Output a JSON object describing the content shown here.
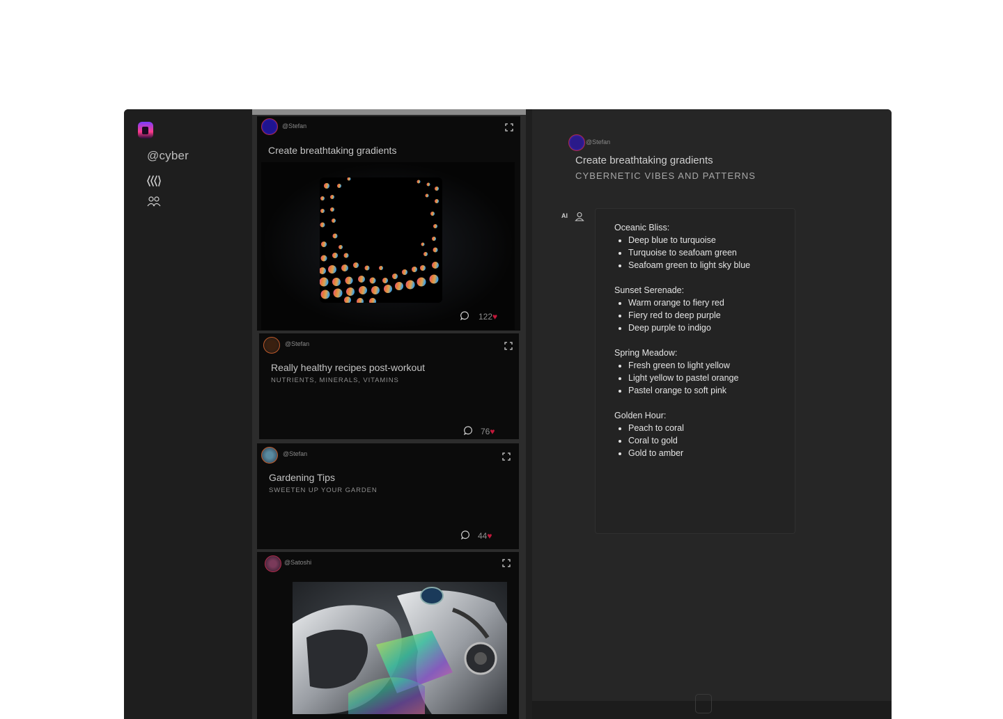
{
  "sidebar": {
    "username": "@cyber",
    "icons": [
      "logo-icon",
      "feed-icon",
      "people-icon"
    ]
  },
  "feed": {
    "cards": [
      {
        "handle": "@Stefan",
        "title": "Create breathtaking gradients",
        "subtitle": "",
        "likes": "122",
        "has_image": true
      },
      {
        "handle": "@Stefan",
        "title": "Really healthy recipes post-workout",
        "subtitle": "NUTRIENTS, MINERALS, VITAMINS",
        "likes": "76"
      },
      {
        "handle": "@Stefan",
        "title": "Gardening Tips",
        "subtitle": "SWEETEN UP YOUR GARDEN",
        "likes": "44"
      },
      {
        "handle": "@Satoshi",
        "title": "",
        "subtitle": "",
        "has_image": true
      }
    ]
  },
  "detail": {
    "handle": "@Stefan",
    "title": "Create breathtaking gradients",
    "subtitle": "CYBERNETIC VIBES AND PATTERNS",
    "ai_label": "AI",
    "answer": [
      {
        "heading": "Oceanic Bliss:",
        "items": [
          "Deep blue to turquoise",
          "Turquoise to seafoam green",
          "Seafoam green to light sky blue"
        ]
      },
      {
        "heading": "Sunset Serenade:",
        "items": [
          "Warm orange to fiery red",
          "Fiery red to deep purple",
          "Deep purple to indigo"
        ]
      },
      {
        "heading": "Spring Meadow:",
        "items": [
          "Fresh green to light yellow",
          "Light yellow to pastel orange",
          "Pastel orange to soft pink"
        ]
      },
      {
        "heading": "Golden Hour:",
        "items": [
          "Peach to coral",
          "Coral to gold",
          "Gold to amber"
        ]
      }
    ]
  },
  "colors": {
    "heart": "#c2183a",
    "app_bg": "#1f1f1f",
    "card_bg": "#0b0b0b"
  }
}
